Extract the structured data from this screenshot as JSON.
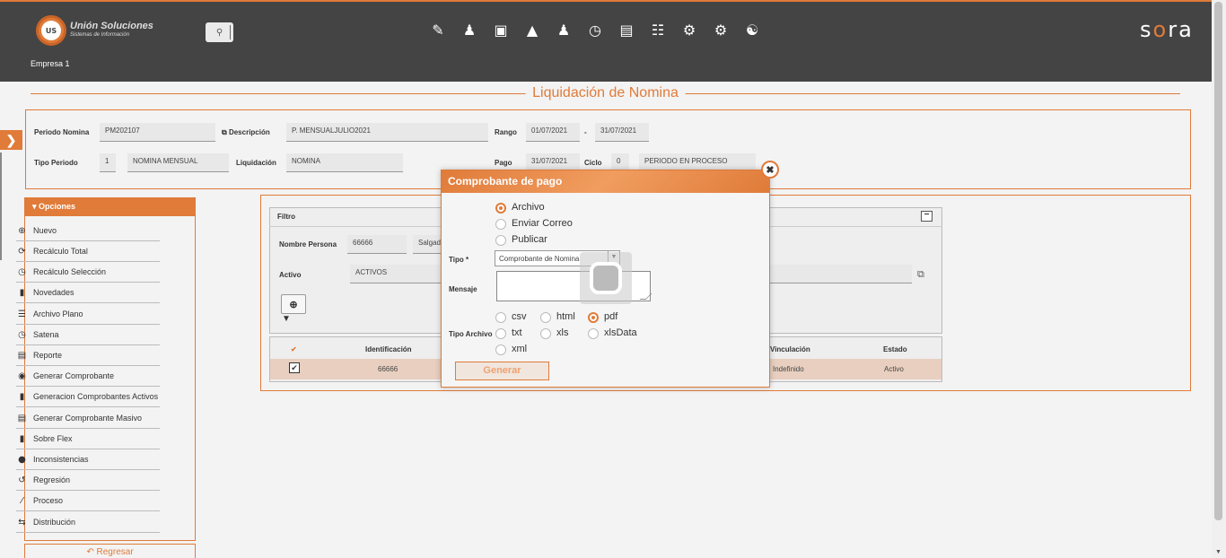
{
  "header": {
    "logo_line1": "Unión Soluciones",
    "logo_line2": "Sistemas de Información",
    "logo_mark": "US",
    "company": "Empresa 1",
    "brand_a": "s",
    "brand_o": "o",
    "brand_b": "ra",
    "modules": [
      "form-icon",
      "person-icon",
      "gift-icon",
      "org-icon",
      "people-icon",
      "timer-icon",
      "document-icon",
      "board-icon",
      "gears-icon",
      "cert-icon",
      "group-icon"
    ]
  },
  "page": {
    "title": "Liquidación de Nomina"
  },
  "form": {
    "periodo_label": "Periodo Nomina",
    "periodo_value": "PM202107",
    "descripcion_label": "Descripción",
    "descripcion_value": "P. MENSUALJULIO2021",
    "rango_label": "Rango",
    "rango_from": "01/07/2021",
    "rango_sep": "-",
    "rango_to": "31/07/2021",
    "tipo_periodo_label": "Tipo Periodo",
    "tipo_periodo_code": "1",
    "tipo_periodo_value": "NOMINA MENSUAL",
    "liquidacion_label": "Liquidación",
    "liquidacion_value": "NOMINA",
    "pago_label": "Pago",
    "pago_value": "31/07/2021",
    "ciclo_label": "Ciclo",
    "ciclo_value": "0",
    "estado_value": "PERIODO EN PROCESO"
  },
  "opciones": {
    "title": "Opciones",
    "items": [
      {
        "label": "Nuevo",
        "icon": "plus-circle-icon"
      },
      {
        "label": "Recálculo Total",
        "icon": "refresh-icon"
      },
      {
        "label": "Recálculo Selección",
        "icon": "clock-icon"
      },
      {
        "label": "Novedades",
        "icon": "chat-icon"
      },
      {
        "label": "Archivo Plano",
        "icon": "lines-icon"
      },
      {
        "label": "Satena",
        "icon": "clock-icon"
      },
      {
        "label": "Reporte",
        "icon": "report-icon"
      },
      {
        "label": "Generar Comprobante",
        "icon": "eye-icon"
      },
      {
        "label": "Generacion Comprobantes Activos",
        "icon": "doc-icon"
      },
      {
        "label": "Generar Comprobante Masivo",
        "icon": "report-icon"
      },
      {
        "label": "Sobre Flex",
        "icon": "doc-icon"
      },
      {
        "label": "Inconsistencias",
        "icon": "alert-icon"
      },
      {
        "label": "Regresión",
        "icon": "undo-icon"
      },
      {
        "label": "Proceso",
        "icon": "clip-icon"
      },
      {
        "label": "Distribución",
        "icon": "swap-icon"
      }
    ],
    "regresar": "Regresar"
  },
  "filtro": {
    "title": "Filtro",
    "nombre_label": "Nombre Persona",
    "nombre_code": "66666",
    "nombre_value": "Salgad",
    "activo_label": "Activo",
    "activo_value": "ACTIVOS"
  },
  "grid": {
    "headers": {
      "check": "✔",
      "identificacion": "Identificación",
      "vinculacion": "Vinculación",
      "estado": "Estado"
    },
    "row": {
      "identificacion": "66666",
      "vinculacion": "Indefinido",
      "estado": "Activo"
    }
  },
  "dialog": {
    "title": "Comprobante de pago",
    "opciones": [
      {
        "label": "Archivo",
        "selected": true
      },
      {
        "label": "Enviar Correo",
        "selected": false
      },
      {
        "label": "Publicar",
        "selected": false
      }
    ],
    "tipo_label": "Tipo *",
    "tipo_value": "Comprobante de Nomina",
    "mensaje_label": "Mensaje",
    "tipo_archivo_label": "Tipo Archivo",
    "formatos": [
      {
        "label": "csv",
        "selected": false
      },
      {
        "label": "html",
        "selected": false
      },
      {
        "label": "pdf",
        "selected": true
      },
      {
        "label": "txt",
        "selected": false
      },
      {
        "label": "xls",
        "selected": false
      },
      {
        "label": "xlsData",
        "selected": false
      },
      {
        "label": "xml",
        "selected": false
      }
    ],
    "generar": "Generar"
  }
}
